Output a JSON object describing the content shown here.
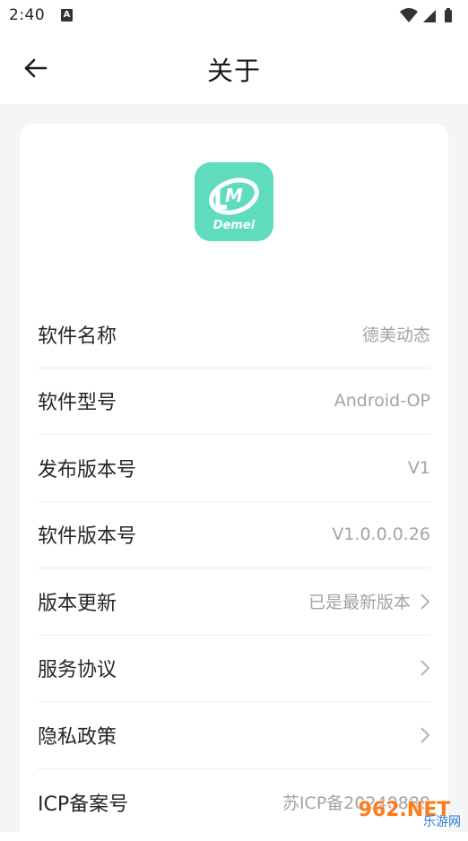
{
  "status_bar": {
    "time": "2:40",
    "notification_icon": "A"
  },
  "header": {
    "back_icon": "arrow-left-icon",
    "title": "关于"
  },
  "app": {
    "logo_text": "Demei",
    "brand_color": "#5fdcbe"
  },
  "info_rows": [
    {
      "label": "软件名称",
      "value": "德美动态",
      "chevron": false
    },
    {
      "label": "软件型号",
      "value": "Android-OP",
      "chevron": false
    },
    {
      "label": "发布版本号",
      "value": "V1",
      "chevron": false
    },
    {
      "label": "软件版本号",
      "value": "V1.0.0.0.26",
      "chevron": false
    },
    {
      "label": "版本更新",
      "value": "已是最新版本",
      "chevron": true
    },
    {
      "label": "服务协议",
      "value": "",
      "chevron": true
    },
    {
      "label": "隐私政策",
      "value": "",
      "chevron": true
    },
    {
      "label": "ICP备案号",
      "value": "苏ICP备20240888",
      "chevron": false
    }
  ],
  "watermark": {
    "main": "962.NET",
    "sub": "乐游网"
  }
}
